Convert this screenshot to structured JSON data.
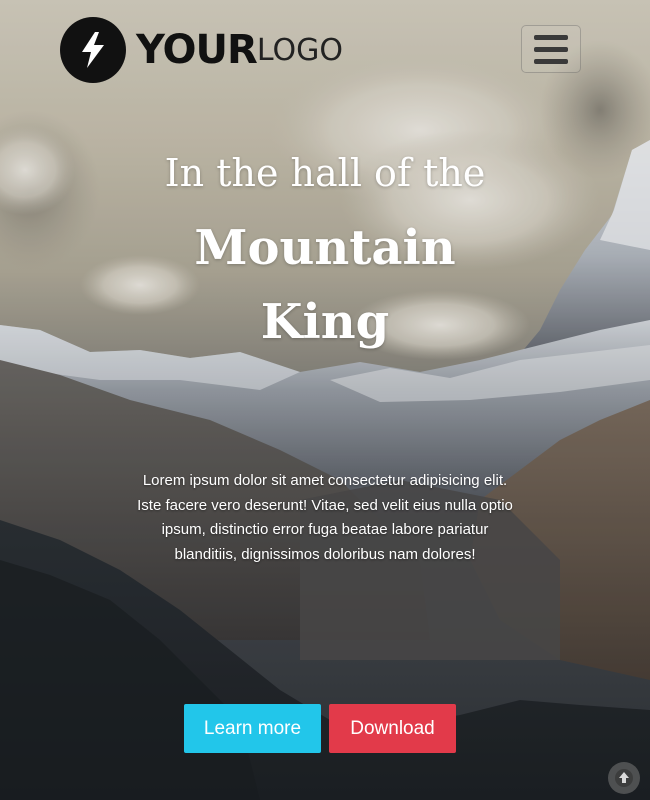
{
  "header": {
    "logo_strong": "YOUR",
    "logo_light": "LOGO",
    "logo_icon": "lightning-bolt-icon",
    "menu_icon": "hamburger-menu-icon"
  },
  "hero": {
    "title_line1": "In the hall of the",
    "title_line2": "Mountain",
    "title_line3": "King",
    "body": "Lorem ipsum dolor sit amet consectetur adipisicing elit. Iste facere vero deserunt! Vitae, sed velit eius nulla optio ipsum, distinctio error fuga beatae labore pariatur blanditiis, dignissimos doloribus nam dolores!"
  },
  "buttons": {
    "learn_more": "Learn more",
    "download": "Download"
  },
  "colors": {
    "learn_more_bg": "#22c6ea",
    "download_bg": "#e23a4a",
    "text": "#ffffff"
  },
  "scroll_top_icon": "arrow-up-icon"
}
